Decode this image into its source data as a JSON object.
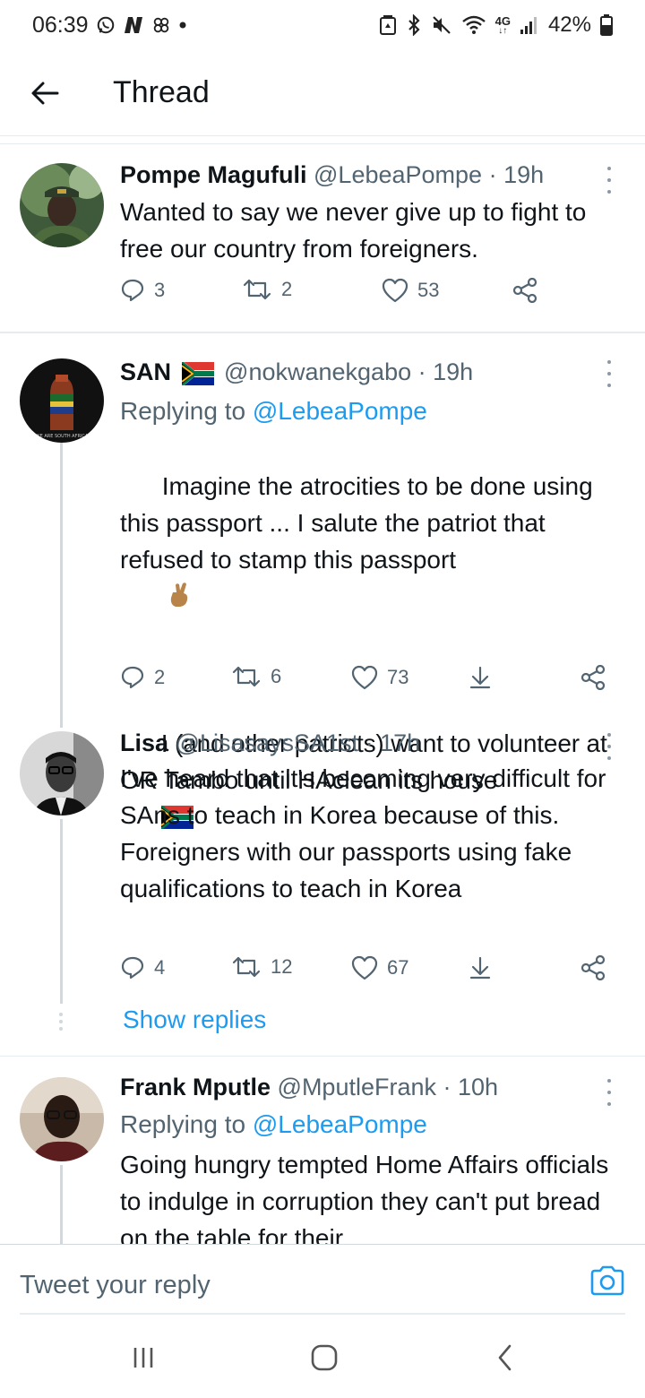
{
  "status_bar": {
    "time": "06:39",
    "battery": "42%",
    "network": "4G",
    "left_icons": [
      "whatsapp-icon",
      "n-app-icon",
      "pinwheel-icon",
      "dot-icon"
    ],
    "right_icons": [
      "app-badge-icon",
      "bluetooth-icon",
      "mute-icon",
      "wifi-icon",
      "signal-icon",
      "battery-icon"
    ]
  },
  "header": {
    "title": "Thread"
  },
  "tweets": [
    {
      "name": "Pompe Magufuli",
      "handle": "@LebeaPompe",
      "time": "· 19h",
      "text": "Wanted to say we never give up to fight to free our country from foreigners.",
      "replies": "3",
      "retweets": "2",
      "likes": "53"
    },
    {
      "name": "SAN",
      "handle": "@nokwanekgabo",
      "time": "· 19h",
      "replying_prefix": "Replying to ",
      "replying_to": "@LebeaPompe",
      "text_1": "Imagine the atrocities to be done using this passport ... I salute the patriot that refused to stamp this passport",
      "text_2": "I (and other patriots) want to volunteer at OR Tambo until HAclean its house",
      "avatar_caption": "WE ARE SOUTH AFRICA",
      "replies": "2",
      "retweets": "6",
      "likes": "73"
    },
    {
      "name": "Lisa",
      "handle": "@LisasaysSA1st",
      "time": "· 17h",
      "text": "I've heard that it's becoming very difficult for SAns to teach in Korea because of this. Foreigners with our passports using fake qualifications to teach in Korea",
      "replies": "4",
      "retweets": "12",
      "likes": "67"
    },
    {
      "name": "Frank Mputle",
      "handle": "@MputleFrank",
      "time": "· 10h",
      "replying_prefix": "Replying to ",
      "replying_to": "@LebeaPompe",
      "text": "Going hungry tempted Home Affairs officials to indulge in corruption they can't put bread on the table for their"
    }
  ],
  "show_replies": "Show replies",
  "reply_bar": {
    "placeholder": "Tweet your reply"
  },
  "colors": {
    "accent": "#1d9bf0",
    "secondary_text": "#536471",
    "divider": "#e6ecf0"
  }
}
